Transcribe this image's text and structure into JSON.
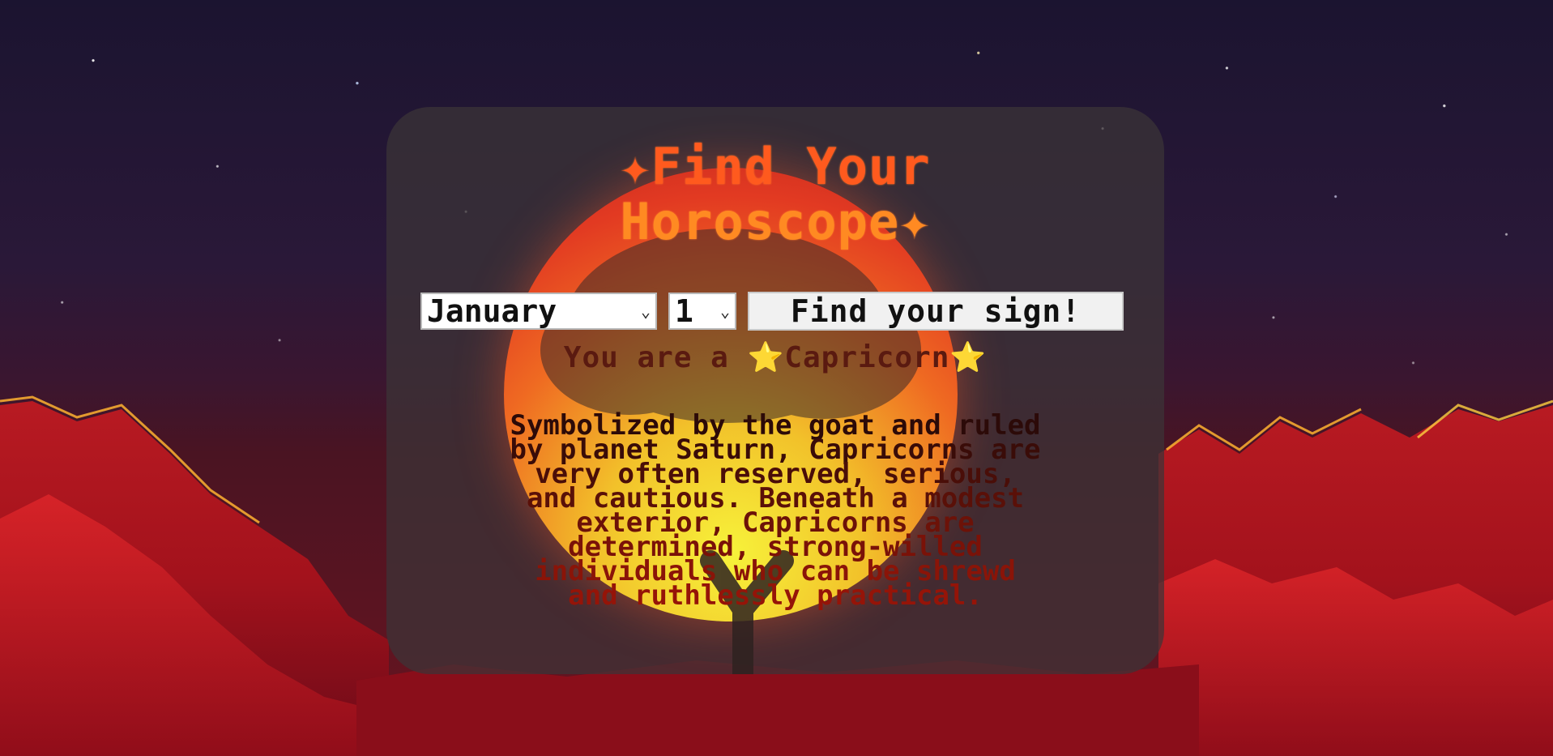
{
  "page": {
    "title_line1": "✦Find Your",
    "title_line2": "Horoscope✦"
  },
  "form": {
    "month_selected": "January",
    "day_selected": "1",
    "submit_label": "Find your sign!"
  },
  "result": {
    "text": "You are a ⭐Capricorn⭐"
  },
  "description": {
    "lines": [
      "Symbolized by the goat and ruled",
      "by planet Saturn, Capricorns are",
      "very often reserved, serious,",
      "and cautious. Beneath a modest",
      "exterior, Capricorns are",
      "determined, strong-willed",
      "individuals who can be shrewd",
      "and ruthlessly practical."
    ]
  },
  "colors": {
    "title": "#ff5a1e",
    "card_bg": "#3c3438",
    "sun_top": "#e23a22",
    "sun_bottom": "#f7f23a",
    "text_dark_red": "#5a1a10"
  },
  "icons": {
    "title_sparkle": "sparkle-icon",
    "result_star": "star-icon",
    "select_caret": "chevron-down-icon"
  }
}
